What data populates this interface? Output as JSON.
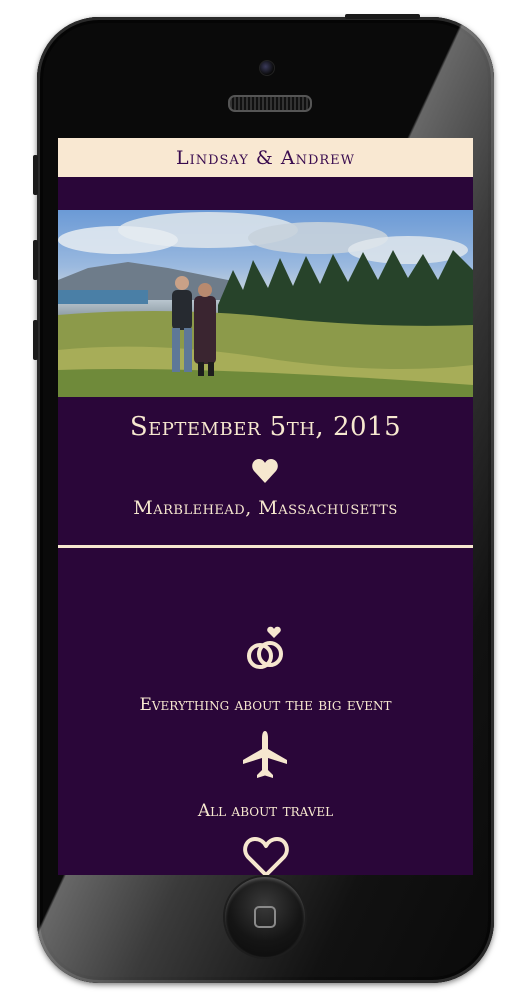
{
  "site": {
    "title": "Lindsay & Andrew"
  },
  "hero": {
    "photo_icon": "couple-photo",
    "date": "September 5th, 2015",
    "heart_icon": "heart-icon",
    "location": "Marblehead, Massachusetts"
  },
  "nav": {
    "items": [
      {
        "icon": "rings-icon",
        "label": "Everything about the big event"
      },
      {
        "icon": "airplane-icon",
        "label": "All about travel"
      },
      {
        "icon": "heart-outline-icon",
        "label": ""
      }
    ]
  },
  "colors": {
    "background": "#2a0639",
    "cream": "#f6e7cf",
    "header_bg": "#f9e8d2",
    "header_text": "#3a0c4f"
  }
}
